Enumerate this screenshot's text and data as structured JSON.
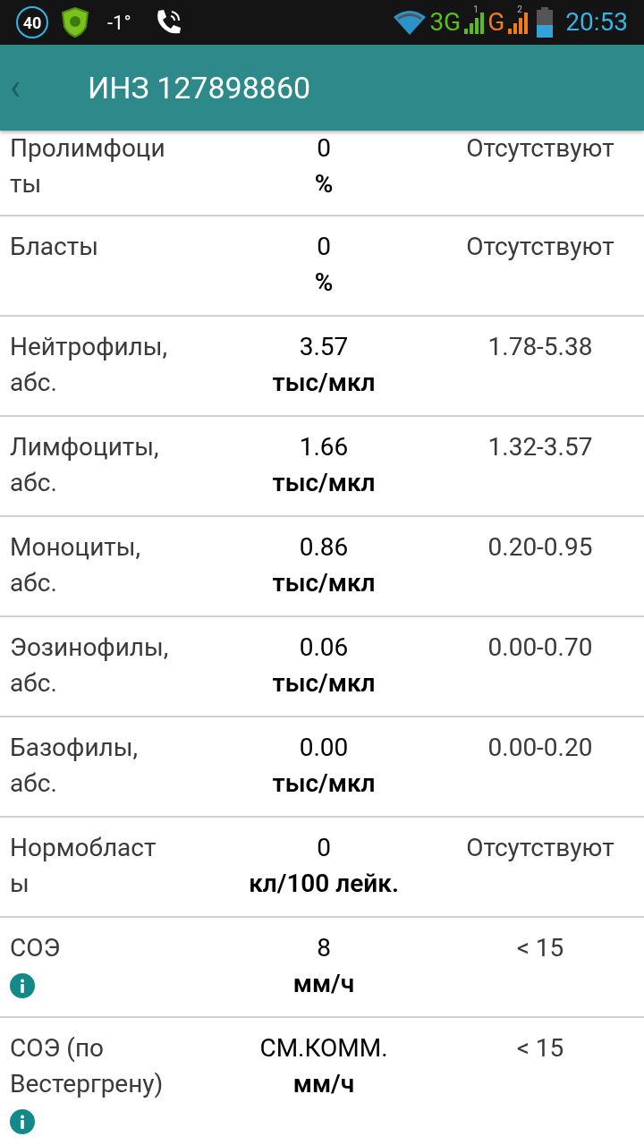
{
  "status_bar": {
    "badge": "40",
    "temperature": "-1°",
    "network_3g": "3G",
    "sim1": "1",
    "network_g": "G",
    "sim2": "2",
    "time": "20:53"
  },
  "header": {
    "back": "‹",
    "title": "ИНЗ 127898860"
  },
  "rows": [
    {
      "name": [
        "Пролимфоци",
        "ты"
      ],
      "value": "0",
      "unit": "%",
      "reference": "Отсутствуют",
      "info": false
    },
    {
      "name": [
        "Бласты"
      ],
      "value": "0",
      "unit": "%",
      "reference": "Отсутствуют",
      "info": false
    },
    {
      "name": [
        "Нейтрофилы,",
        "абс."
      ],
      "value": "3.57",
      "unit": "тыс/мкл",
      "reference": "1.78-5.38",
      "info": false
    },
    {
      "name": [
        "Лимфоциты,",
        "абс."
      ],
      "value": "1.66",
      "unit": "тыс/мкл",
      "reference": "1.32-3.57",
      "info": false
    },
    {
      "name": [
        "Моноциты,",
        "абс."
      ],
      "value": "0.86",
      "unit": "тыс/мкл",
      "reference": "0.20-0.95",
      "info": false
    },
    {
      "name": [
        "Эозинофилы,",
        "абс."
      ],
      "value": "0.06",
      "unit": "тыс/мкл",
      "reference": "0.00-0.70",
      "info": false
    },
    {
      "name": [
        "Базофилы,",
        "абс."
      ],
      "value": "0.00",
      "unit": "тыс/мкл",
      "reference": "0.00-0.20",
      "info": false
    },
    {
      "name": [
        "Нормобласт",
        "ы"
      ],
      "value": "0",
      "unit": "кл/100 лейк.",
      "reference": "Отсутствуют",
      "info": false
    },
    {
      "name": [
        "СОЭ"
      ],
      "value": "8",
      "unit": "мм/ч",
      "reference": "< 15",
      "info": true
    },
    {
      "name": [
        "СОЭ (по",
        "Вестергрену)"
      ],
      "value": "СМ.КОММ.",
      "unit": "мм/ч",
      "reference": "< 15",
      "info": true
    }
  ]
}
